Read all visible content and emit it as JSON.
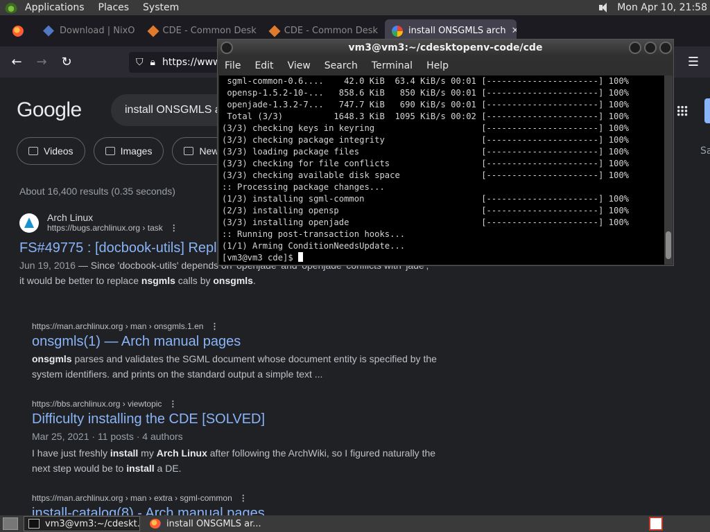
{
  "panel": {
    "menus": [
      "Applications",
      "Places",
      "System"
    ],
    "clock": "Mon Apr 10, 21:58"
  },
  "firefox": {
    "tabs": [
      {
        "label": "Download | NixO",
        "icon": "nixos-icon"
      },
      {
        "label": "CDE - Common Desk",
        "icon": "cde-icon"
      },
      {
        "label": "CDE - Common Desk",
        "icon": "cde-icon"
      },
      {
        "label": "install ONSGMLS arch",
        "icon": "google-icon",
        "active": true
      }
    ],
    "url": "https://www"
  },
  "google": {
    "logo": "Google",
    "query": "install ONSGMLS a",
    "chips": [
      "Videos",
      "Images",
      "News"
    ],
    "truncated_right": "Sa",
    "stats": "About 16,400 results (0.35 seconds)",
    "results": [
      {
        "site": "Arch Linux",
        "cite": "https://bugs.archlinux.org › task",
        "title": "FS#49775 : [docbook-utils] Repl",
        "date": "Jun 19, 2016",
        "snippet_pre": " — Since 'docbook-utils' depends on 'openjade' and 'openjade' conflicts with 'jade', it would be better to replace ",
        "b1": "nsgmls",
        "mid": " calls by ",
        "b2": "onsgmls",
        "end": "."
      },
      {
        "cite": "https://man.archlinux.org › man › onsgmls.1.en",
        "title": "onsgmls(1) — Arch manual pages",
        "b1": "onsgmls",
        "snippet": " parses and validates the SGML document whose document entity is specified by the system identifiers. and prints on the standard output a simple text ..."
      },
      {
        "cite": "https://bbs.archlinux.org › viewtopic",
        "title": "Difficulty installing the CDE [SOLVED]",
        "meta": "Mar 25, 2021 · 11 posts · 4 authors",
        "s1": "I have just freshly ",
        "b1": "install",
        "s2": " my ",
        "b2": "Arch Linux",
        "s3": " after following the ArchWiki, so I figured naturally the next step would be to ",
        "b3": "install",
        "s4": " a DE."
      },
      {
        "cite": "https://man.archlinux.org › man › extra › sgml-common",
        "title": "install-catalog(8) - Arch manual pages"
      }
    ]
  },
  "terminal": {
    "title": "vm3@vm3:~/cdesktopenv-code/cde",
    "menu": [
      "File",
      "Edit",
      "View",
      "Search",
      "Terminal",
      "Help"
    ],
    "lines": [
      " sgml-common-0.6....    42.0 KiB  63.4 KiB/s 00:01 [----------------------] 100%",
      " opensp-1.5.2-10-...   858.6 KiB   850 KiB/s 00:01 [----------------------] 100%",
      " openjade-1.3.2-7...   747.7 KiB   690 KiB/s 00:01 [----------------------] 100%",
      " Total (3/3)          1648.3 KiB  1095 KiB/s 00:02 [----------------------] 100%",
      "(3/3) checking keys in keyring                     [----------------------] 100%",
      "(3/3) checking package integrity                   [----------------------] 100%",
      "(3/3) loading package files                        [----------------------] 100%",
      "(3/3) checking for file conflicts                  [----------------------] 100%",
      "(3/3) checking available disk space                [----------------------] 100%",
      ":: Processing package changes...",
      "(1/3) installing sgml-common                       [----------------------] 100%",
      "(2/3) installing opensp                            [----------------------] 100%",
      "(3/3) installing openjade                          [----------------------] 100%",
      ":: Running post-transaction hooks...",
      "(1/1) Arming ConditionNeedsUpdate..."
    ],
    "prompt": "[vm3@vm3 cde]$ "
  },
  "taskbar": {
    "items": [
      {
        "label": "vm3@vm3:~/cdeskt...",
        "icon": "terminal-icon"
      },
      {
        "label": "install ONSGMLS ar...",
        "icon": "firefox-icon"
      }
    ]
  }
}
